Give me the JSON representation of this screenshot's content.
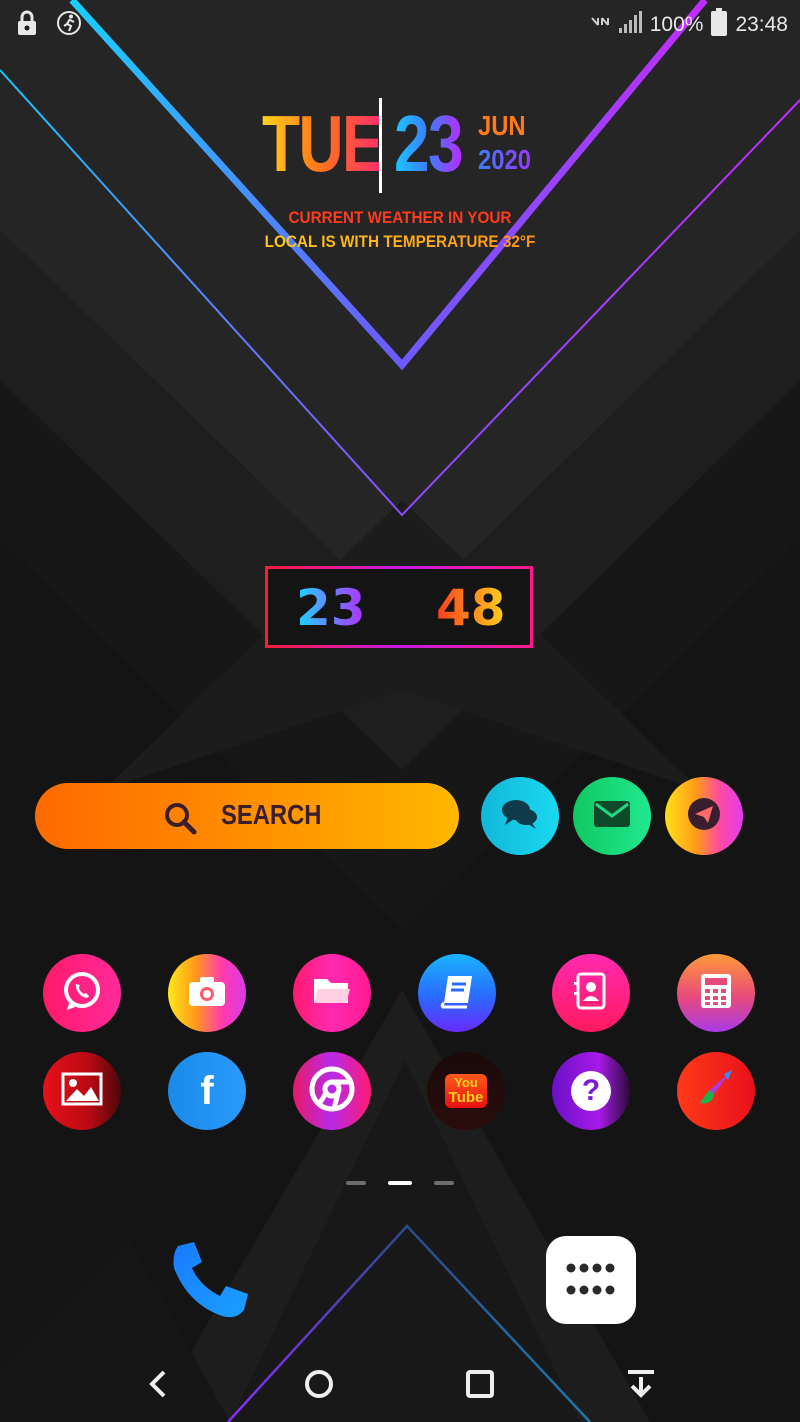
{
  "status_bar": {
    "battery": "100%",
    "time": "23:48",
    "icons": [
      "lock-icon",
      "running-icon",
      "no-network-icon",
      "signal-icon",
      "battery-icon"
    ]
  },
  "date_widget": {
    "day": "TUE",
    "date": "23",
    "month": "JUN",
    "year": "2020",
    "weather_line1": "CURRENT WEATHER IN YOUR",
    "weather_line2": "LOCAL IS  WITH TEMPERATURE 32°F"
  },
  "clock": {
    "hours": "23",
    "minutes": "48"
  },
  "search": {
    "label": "SEARCH",
    "icon": "search-icon"
  },
  "quick_apps": [
    {
      "name": "messages-app",
      "icon": "chat-bubbles-icon"
    },
    {
      "name": "email-app",
      "icon": "envelope-icon"
    },
    {
      "name": "telegram-app",
      "icon": "paper-plane-icon"
    }
  ],
  "apps_row1": [
    {
      "name": "whatsapp-app",
      "icon": "whatsapp-icon"
    },
    {
      "name": "camera-app",
      "icon": "camera-icon"
    },
    {
      "name": "files-app",
      "icon": "folder-icon"
    },
    {
      "name": "notes-app",
      "icon": "book-icon"
    },
    {
      "name": "contacts-app",
      "icon": "contacts-icon"
    },
    {
      "name": "calculator-app",
      "icon": "calculator-icon"
    }
  ],
  "apps_row2": [
    {
      "name": "gallery-app",
      "icon": "image-icon"
    },
    {
      "name": "facebook-app",
      "icon": "facebook-icon"
    },
    {
      "name": "chrome-app",
      "icon": "chrome-icon"
    },
    {
      "name": "youtube-app",
      "icon": "youtube-icon"
    },
    {
      "name": "help-app",
      "icon": "question-icon"
    },
    {
      "name": "paint-app",
      "icon": "brush-icon"
    }
  ],
  "youtube_text": {
    "top": "You",
    "bottom": "Tube"
  },
  "facebook_text": "f",
  "help_text": "?",
  "page_indicator": {
    "count": 3,
    "active": 1
  },
  "dock": [
    {
      "name": "phone-app",
      "icon": "phone-icon"
    },
    {
      "name": "app-drawer",
      "icon": "grid-dots-icon"
    }
  ],
  "nav_bar": [
    "back-icon",
    "home-icon",
    "recents-icon",
    "pull-down-icon"
  ],
  "colors": {
    "background": "#1a1a1a",
    "accent_cyan": "#18c8ff",
    "accent_purple": "#b92cff",
    "search_orange": "#ff8a00"
  }
}
